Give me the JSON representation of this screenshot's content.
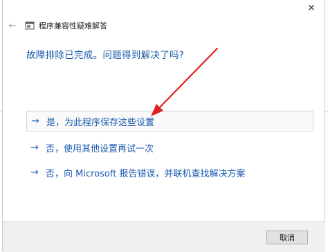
{
  "window": {
    "title": "程序兼容性疑难解答",
    "close_glyph": "✕"
  },
  "nav": {
    "back_glyph": "←"
  },
  "question": "故障排除已完成。问题得到解决了吗?",
  "options": [
    {
      "arrow": "→",
      "label": "是，为此程序保存这些设置"
    },
    {
      "arrow": "→",
      "label": "否，使用其他设置再试一次"
    },
    {
      "arrow": "→",
      "label": "否，向 Microsoft 报告错误，并联机查找解决方案"
    }
  ],
  "footer": {
    "cancel_label": "取消"
  },
  "colors": {
    "link_blue": "#1b5bb0",
    "annotation_red": "#e02020"
  }
}
